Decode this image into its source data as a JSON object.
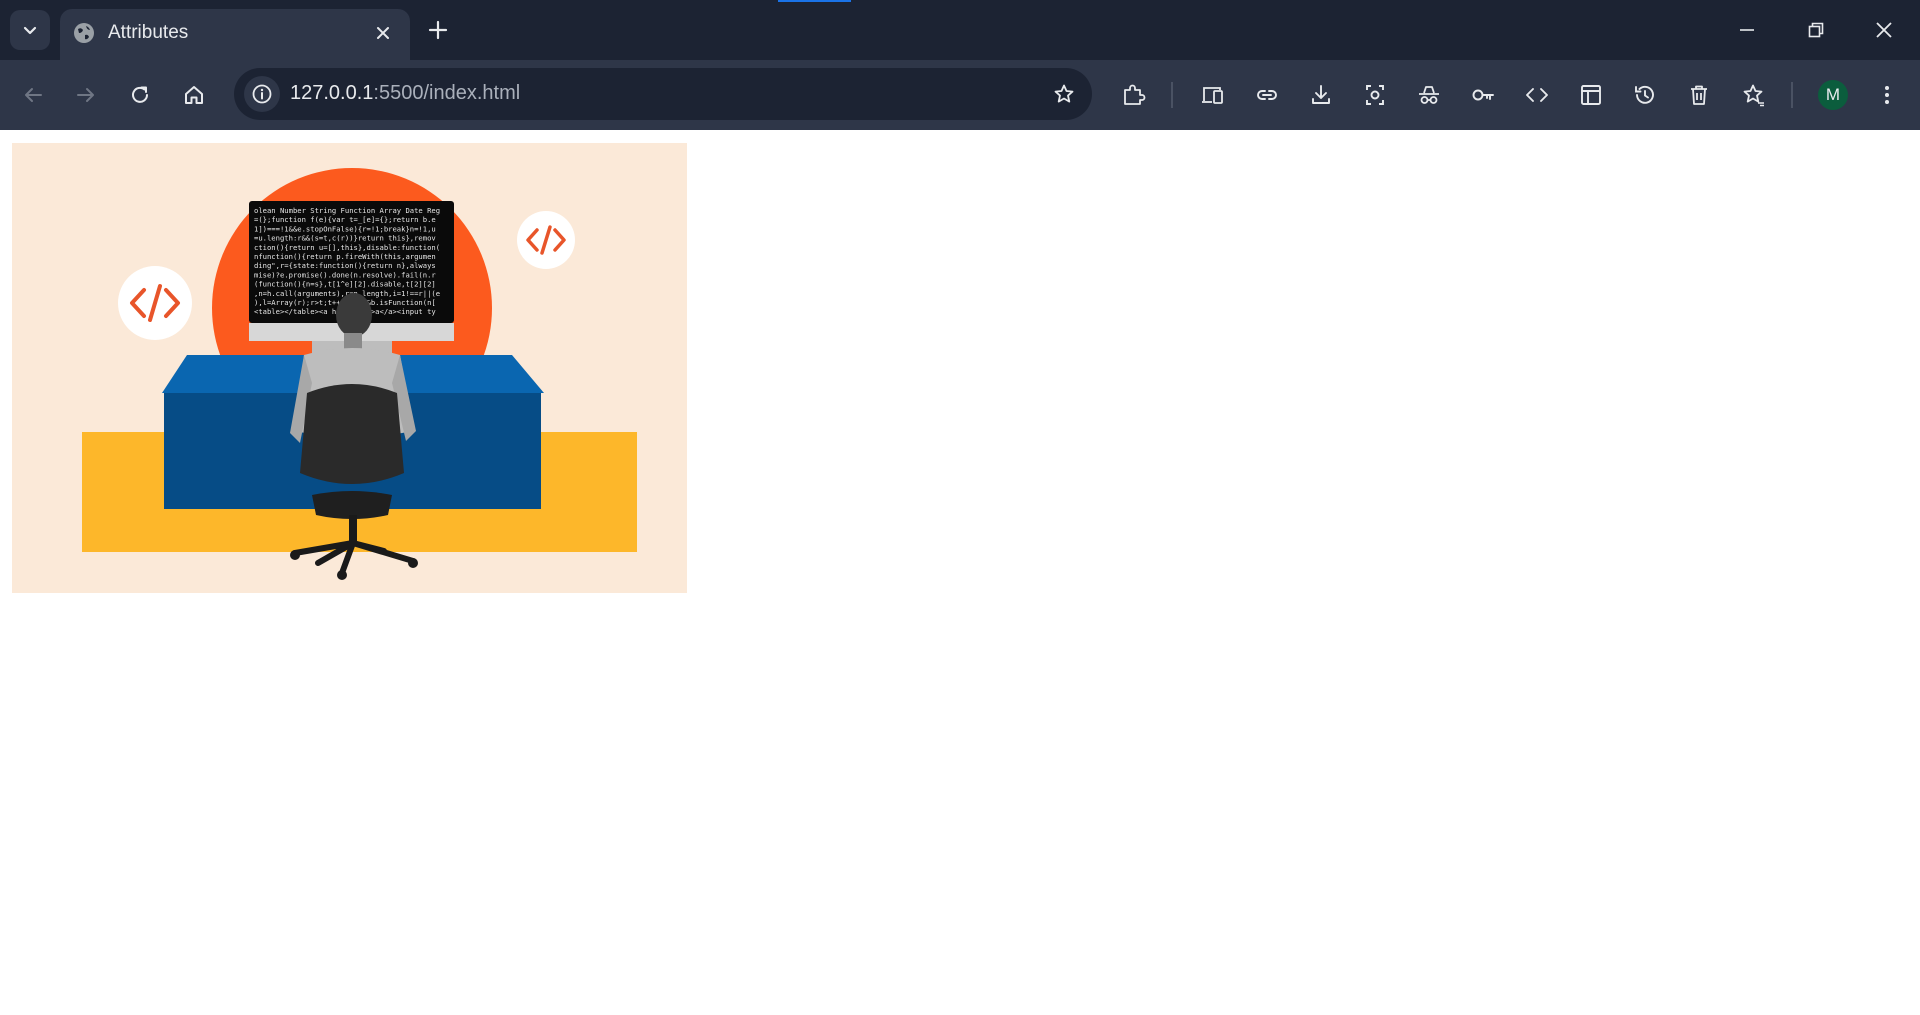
{
  "browser": {
    "tab": {
      "title": "Attributes"
    },
    "address_bar": {
      "host": "127.0.0.1",
      "path": ":5500/index.html"
    },
    "profile": {
      "initial": "M",
      "color": "#0b5d3d"
    },
    "accent": "#1a73e8"
  },
  "page": {
    "image": {
      "content": "illustration: person in office chair facing a monitor showing code, with code-tag badges",
      "code_lines": [
        "olean Number String Function Array Date Reg",
        "=(};function f(e){var t=_[e]={};return b.e",
        "1])===!1&&e.stopOnFalse){r=!1;break}n=!1,u",
        "=u.length:r&&(s=t,c(r))}return this},remov",
        "ction(){return u=[],this},disable:function(",
        "nfunction(){return p.fireWith(this,argumen",
        "ding\",r={state:function(){return n},always",
        "mise)?e.promise().done(n.resolve).fail(n.r",
        "(function(){n=s},t[1^e][2].disable,t[2][2]",
        ",n=h.call(arguments),r=n.length,i=1!==r||(e",
        "),l=Array(r);r>t;t++)n[t]&&b.isFunction(n[",
        "<table></table><a href='/a'>a</a><input ty"
      ],
      "colors": {
        "background": "#fbe9d8",
        "sun": "#fc5a1e",
        "desk_top": "#0a66b0",
        "desk_front": "#064c86",
        "floor": "#fdb72a",
        "code_tag": "#e8552a"
      }
    }
  }
}
